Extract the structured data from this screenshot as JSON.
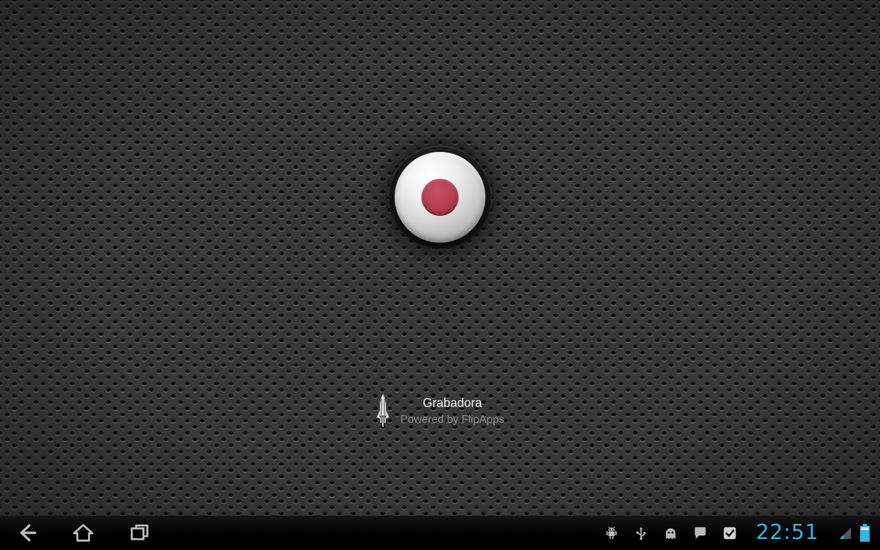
{
  "app": {
    "title": "Grabadora",
    "subtitle": "Powered by FlipApps",
    "colors": {
      "background": "#383838",
      "record_red": "#b23b4b",
      "metal": "#d2d2d2"
    },
    "icons": {
      "logo": "rocket-logo-icon",
      "record": "record-dot-icon"
    }
  },
  "system_bar": {
    "time": "22:51",
    "colors": {
      "accent": "#33b5e5",
      "bar_background": "#000000",
      "icon_gray": "#b8b8b8"
    },
    "nav_buttons": [
      {
        "name": "back-button",
        "icon": "back-icon"
      },
      {
        "name": "home-button",
        "icon": "home-icon"
      },
      {
        "name": "recent-apps-button",
        "icon": "recent-apps-icon"
      }
    ],
    "status_icons": [
      "usb-debugging-icon",
      "usb-connected-icon",
      "ghost-notification-icon",
      "chat-notification-icon",
      "checkmark-notification-icon",
      "signal-strength-icon",
      "battery-icon"
    ]
  }
}
